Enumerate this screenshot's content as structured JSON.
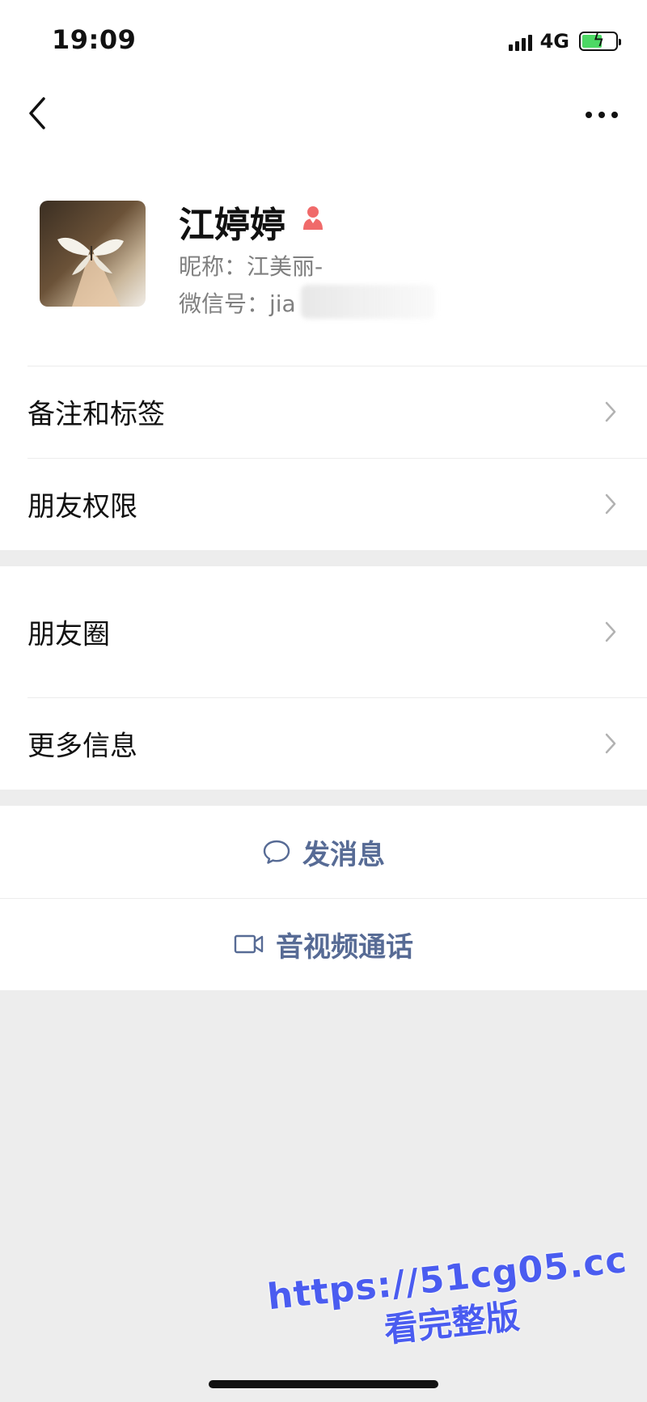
{
  "status_bar": {
    "time": "19:09",
    "network": "4G"
  },
  "nav": {
    "back_icon": "chevron-left-icon",
    "more_icon": "ellipsis-icon"
  },
  "profile": {
    "name": "江婷婷",
    "gender_icon": "female-icon",
    "nickname": "昵称：江美丽-",
    "wechat_id": "微信号：jia"
  },
  "menu_group_1": [
    {
      "label": "备注和标签"
    },
    {
      "label": "朋友权限"
    }
  ],
  "menu_group_2": [
    {
      "label": "朋友圈"
    },
    {
      "label": "更多信息"
    }
  ],
  "actions": {
    "message": {
      "label": "发消息",
      "icon": "chat-bubble-icon"
    },
    "call": {
      "label": "音视频通话",
      "icon": "video-camera-icon"
    }
  },
  "watermark": {
    "url": "https://51cg05.cc",
    "text": "看完整版"
  },
  "colors": {
    "link": "#576b95",
    "background": "#ededed",
    "battery": "#4cd964",
    "watermark": "#4a5cf0",
    "gender": "#f06a6a"
  }
}
